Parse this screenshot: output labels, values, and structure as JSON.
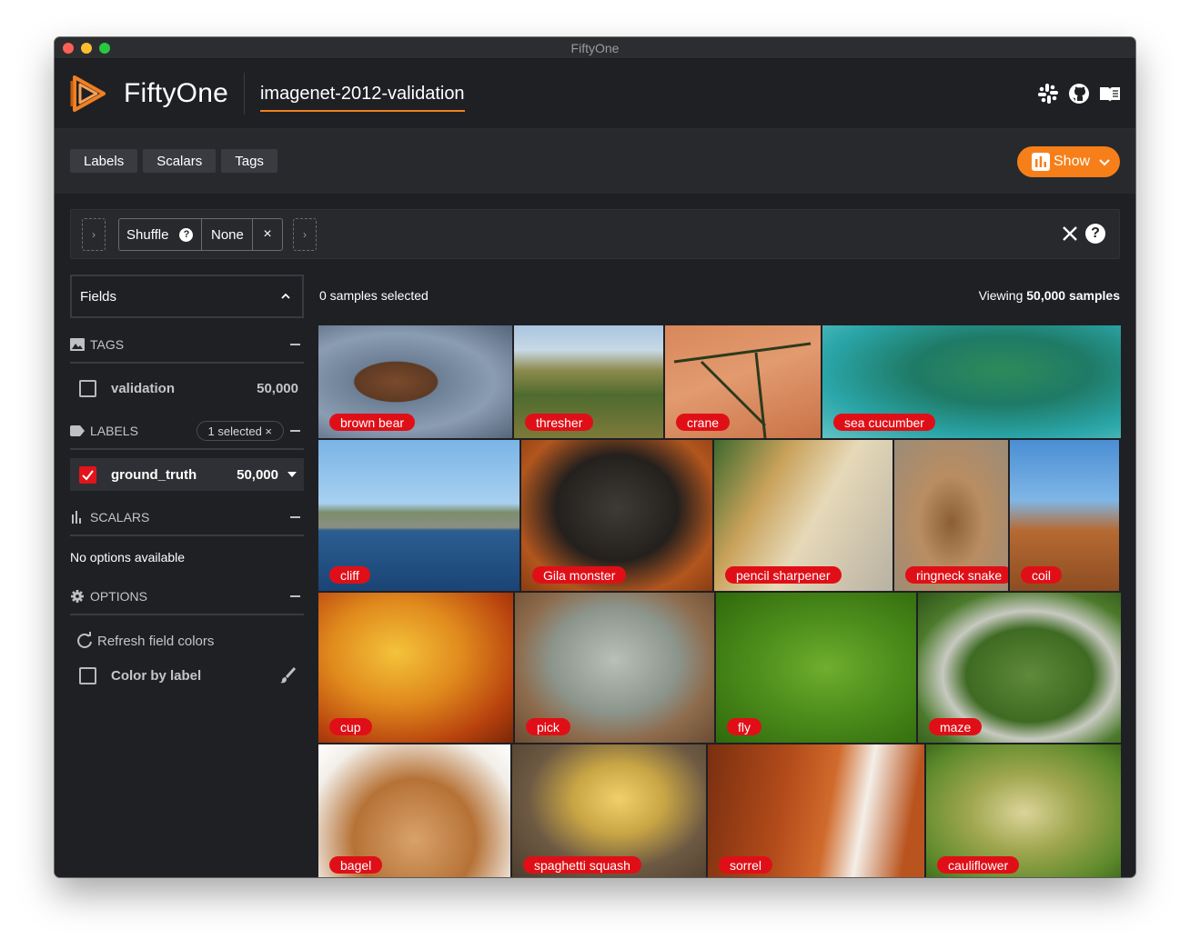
{
  "window": {
    "title": "FiftyOne"
  },
  "header": {
    "app_name": "FiftyOne",
    "dataset_name": "imagenet-2012-validation",
    "icons": [
      "slack-icon",
      "github-icon",
      "docs-book-icon"
    ],
    "accent_color": "#f08022"
  },
  "toolbar": {
    "tabs": [
      "Labels",
      "Scalars",
      "Tags"
    ],
    "show_label": "Show"
  },
  "view_bar": {
    "stage_name": "Shuffle",
    "stage_help": "?",
    "stage_value": "None",
    "stage_remove": "×",
    "add_stage": "›"
  },
  "sidebar": {
    "fields_select": "Fields",
    "tags": {
      "title": "TAGS",
      "items": [
        {
          "label": "validation",
          "count": "50,000",
          "checked": false
        }
      ]
    },
    "labels": {
      "title": "LABELS",
      "selected_pill": "1 selected ×",
      "items": [
        {
          "label": "ground_truth",
          "count": "50,000",
          "checked": true
        }
      ]
    },
    "scalars": {
      "title": "SCALARS",
      "empty": "No options available"
    },
    "options": {
      "title": "OPTIONS",
      "refresh": "Refresh field colors",
      "color_by_label": "Color by label"
    }
  },
  "grid_header": {
    "selected": "0 samples selected",
    "viewing_prefix": "Viewing ",
    "viewing_count": "50,000 samples"
  },
  "label_color": "#e00f17",
  "samples": [
    {
      "label": "brown bear"
    },
    {
      "label": "thresher"
    },
    {
      "label": "crane"
    },
    {
      "label": "sea cucumber"
    },
    {
      "label": "cliff"
    },
    {
      "label": "Gila monster"
    },
    {
      "label": "pencil sharpener"
    },
    {
      "label": "ringneck snake"
    },
    {
      "label": "coil"
    },
    {
      "label": "cup"
    },
    {
      "label": "pick"
    },
    {
      "label": "fly"
    },
    {
      "label": "maze"
    },
    {
      "label": "bagel"
    },
    {
      "label": "spaghetti squash"
    },
    {
      "label": "sorrel"
    },
    {
      "label": "cauliflower"
    }
  ]
}
